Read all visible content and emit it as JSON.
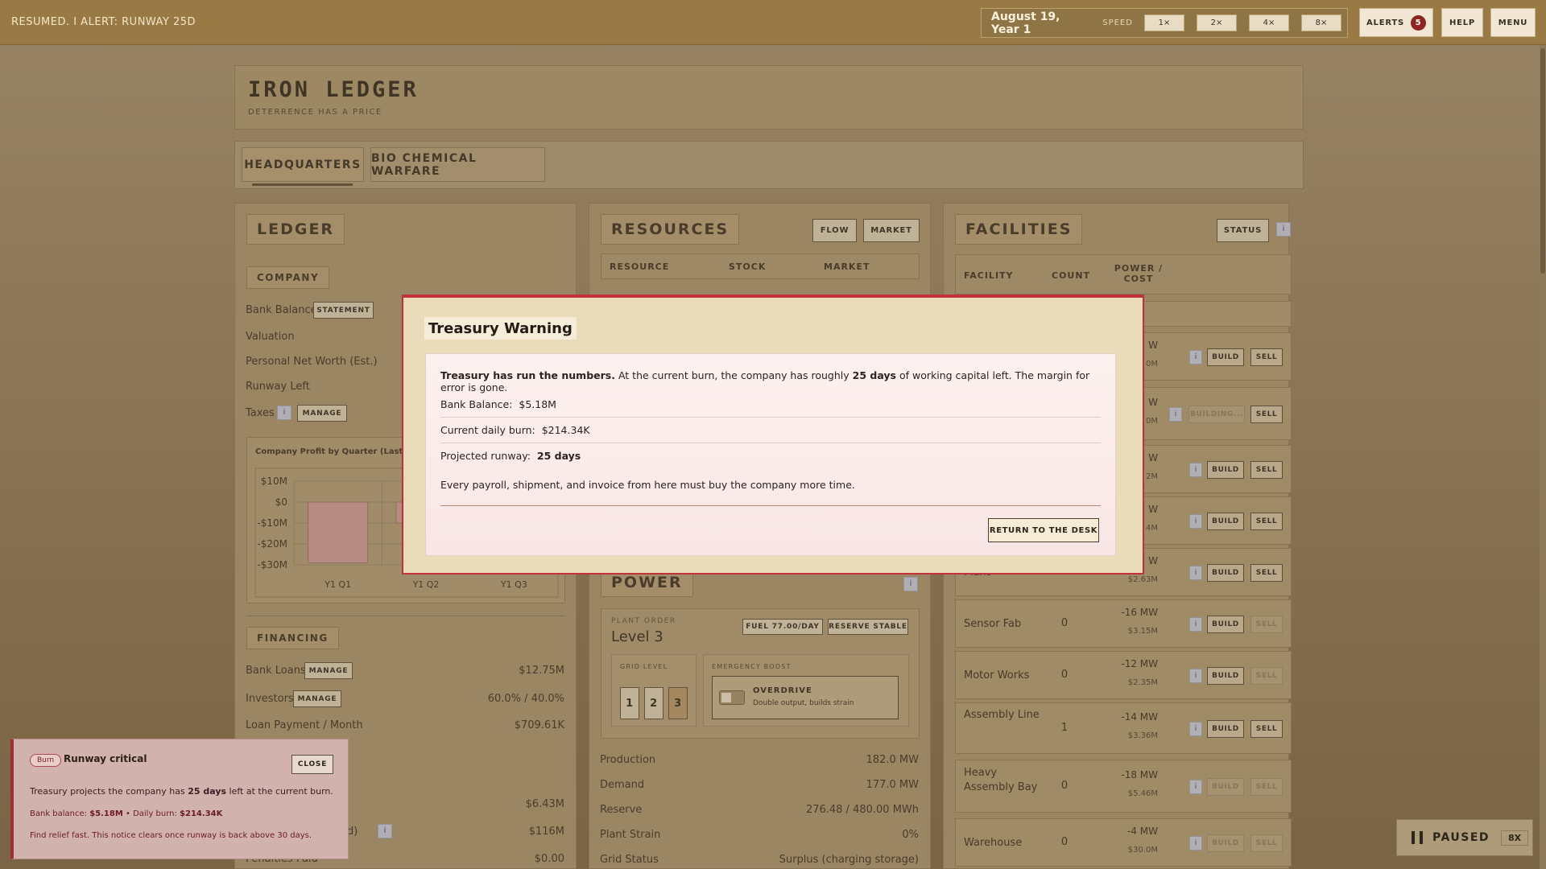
{
  "topbar": {
    "status": "RESUMED. I ALERT: RUNWAY 25D",
    "date": "August 19, Year 1",
    "speed_label": "SPEED",
    "speeds": [
      "1×",
      "2×",
      "4×",
      "8×"
    ],
    "alerts_label": "ALERTS",
    "alerts_count": "5",
    "help_label": "HELP",
    "menu_label": "MENU"
  },
  "header": {
    "title": "IRON LEDGER",
    "tagline": "DETERRENCE HAS A PRICE"
  },
  "tabs": [
    {
      "label": "HEADQUARTERS",
      "active": true
    },
    {
      "label": "BIO CHEMICAL WARFARE",
      "active": false
    }
  ],
  "ledger": {
    "title": "LEDGER",
    "company_title": "COMPANY",
    "bank_balance": "Bank Balance",
    "statement_btn": "STATEMENT",
    "valuation": "Valuation",
    "net_worth": "Personal Net Worth (Est.)",
    "runway_left": "Runway Left",
    "taxes": "Taxes",
    "manage": "MANAGE",
    "chart_title": "Company Profit by Quarter (Last 6 Qu",
    "financing_title": "FINANCING",
    "bank_loans": "Bank Loans",
    "bank_loans_value": "$12.75M",
    "investors": "Investors",
    "investors_value": "60.0% / 40.0%",
    "loan_payment": "Loan Payment / Month",
    "loan_payment_value": "$709.61K",
    "row_a_value": "$6.43M",
    "row_b_label": "ered)",
    "row_b_value": "$116M",
    "penalties": "Penalties Paid",
    "penalties_value": "$0.00"
  },
  "chart_data": {
    "type": "bar",
    "title": "Company Profit by Quarter (Last 6 Qu",
    "categories": [
      "Y1 Q1",
      "Y1 Q2",
      "Y1 Q3"
    ],
    "values": [
      -29,
      -10,
      null
    ],
    "yticks": [
      "$10M",
      "$0",
      "-$10M",
      "-$20M",
      "-$30M"
    ],
    "ylim": [
      -30,
      10
    ],
    "color": "#c99a94"
  },
  "resources": {
    "title": "RESOURCES",
    "flow_btn": "FLOW",
    "market_btn": "MARKET",
    "columns": [
      "RESOURCE",
      "STOCK",
      "MARKET"
    ]
  },
  "power": {
    "title": "POWER",
    "plant_order_label": "PLANT ORDER",
    "level": "Level 3",
    "fuel": "FUEL 77.00/DAY",
    "reserve": "RESERVE STABLE",
    "grid_level_label": "GRID LEVEL",
    "grid_levels": [
      "1",
      "2",
      "3"
    ],
    "emergency_label": "EMERGENCY BOOST",
    "overdrive_title": "OVERDRIVE",
    "overdrive_desc": "Double output, builds strain",
    "stats": [
      {
        "label": "Production",
        "value": "182.0 MW"
      },
      {
        "label": "Demand",
        "value": "177.0 MW"
      },
      {
        "label": "Reserve",
        "value": "276.48 / 480.00 MWh"
      },
      {
        "label": "Plant Strain",
        "value": "0%"
      },
      {
        "label": "Grid Status",
        "value": "Surplus (charging storage)"
      }
    ]
  },
  "facilities": {
    "title": "FACILITIES",
    "status_btn": "STATUS",
    "columns": [
      "FACILITY",
      "COUNT",
      "POWER / COST"
    ],
    "rows": [
      {
        "name": "",
        "count": "",
        "power": "W",
        "cost": "0M",
        "build": "BUILD",
        "sell": "SELL",
        "build_on": true,
        "sell_on": true
      },
      {
        "name": "",
        "count": "",
        "power": "W",
        "cost": "0M",
        "build": "BUILDING...",
        "sell": "SELL",
        "build_on": false,
        "sell_on": true
      },
      {
        "name": "",
        "count": "",
        "power": "W",
        "cost": "2M",
        "build": "BUILD",
        "sell": "SELL",
        "build_on": true,
        "sell_on": true
      },
      {
        "name": "",
        "count": "",
        "power": "W",
        "cost": "4M",
        "build": "BUILD",
        "sell": "SELL",
        "build_on": true,
        "sell_on": true
      },
      {
        "name": "Plant",
        "count": "",
        "power": "W",
        "cost": "$2.63M",
        "build": "BUILD",
        "sell": "SELL",
        "build_on": true,
        "sell_on": true
      },
      {
        "name": "Sensor Fab",
        "count": "0",
        "power": "-16 MW",
        "cost": "$3.15M",
        "build": "BUILD",
        "sell": "SELL",
        "build_on": true,
        "sell_on": false
      },
      {
        "name": "Motor Works",
        "count": "0",
        "power": "-12 MW",
        "cost": "$2.35M",
        "build": "BUILD",
        "sell": "SELL",
        "build_on": true,
        "sell_on": false
      },
      {
        "name": "Assembly Line",
        "count": "1",
        "power": "-14 MW",
        "cost": "$3.36M",
        "build": "BUILD",
        "sell": "SELL",
        "build_on": true,
        "sell_on": true
      },
      {
        "name": "Heavy Assembly Bay",
        "count": "0",
        "power": "-18 MW",
        "cost": "$5.46M",
        "build": "BUILD",
        "sell": "SELL",
        "build_on": false,
        "sell_on": false
      },
      {
        "name": "Warehouse",
        "count": "0",
        "power": "-4 MW",
        "cost": "$30.0M",
        "build": "BUILD",
        "sell": "SELL",
        "build_on": false,
        "sell_on": false
      }
    ]
  },
  "modal": {
    "title": "Treasury Warning",
    "lead_bold": "Treasury has run the numbers.",
    "lead_text": " At the current burn, the company has roughly ",
    "lead_days": "25 days",
    "lead_tail": " of working capital left. The margin for error is gone.",
    "bank_label": "Bank Balance:",
    "bank_value": "$5.18M",
    "burn_label": "Current daily burn:",
    "burn_value": "$214.34K",
    "runway_label": "Projected runway:",
    "runway_value": "25 days",
    "footer_text": "Every payroll, shipment, and invoice from here must buy the company more time.",
    "button": "RETURN TO THE DESK"
  },
  "toast": {
    "tag": "Burn",
    "title": "Runway critical",
    "close": "CLOSE",
    "line1_a": "Treasury projects the company has ",
    "line1_b": "25 days",
    "line1_c": " left at the current burn.",
    "line2_a": "Bank balance: ",
    "line2_b": "$5.18M",
    "line2_c": " • Daily burn: ",
    "line2_d": "$214.34K",
    "line3": "Find relief fast. This notice clears once runway is back above 30 days."
  },
  "paused": {
    "label": "PAUSED",
    "speed": "8X"
  }
}
